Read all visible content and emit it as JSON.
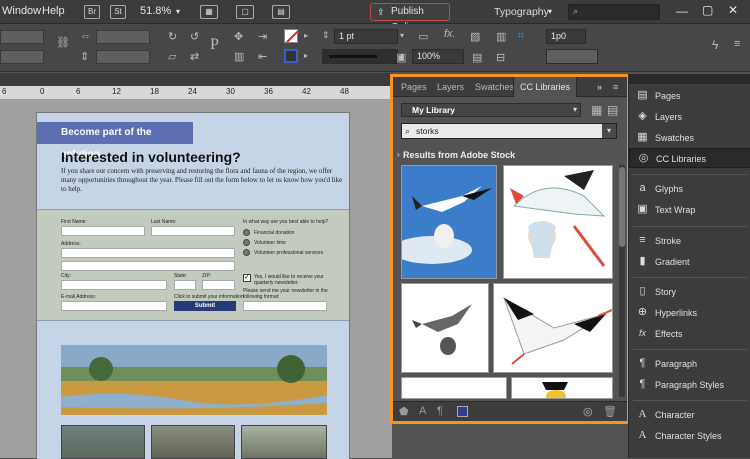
{
  "menu": {
    "window": "Window",
    "help": "Help",
    "zoom": "51.8%",
    "br": "Br",
    "st": "St"
  },
  "toolbar": {
    "publish": "Publish Online",
    "workspace": "Typography"
  },
  "control": {
    "stroke_weight": "1 pt",
    "opacity": "100%",
    "pt_value": "1p0",
    "p_icon": "P"
  },
  "ruler": {
    "numbers": [
      "6",
      "0",
      "6",
      "12",
      "18",
      "24",
      "30",
      "36",
      "42",
      "48"
    ]
  },
  "page": {
    "banner": "Become part of the solution",
    "headline": "Interested in volunteering?",
    "body": "If you share our concern with preserving and restoring the flora and fauna of the region, we offer many opportunities throughout the year. Please fill out the form below to let us know how you'd like to help.",
    "form": {
      "first_name": "First Name:",
      "last_name": "Last Name:",
      "address": "Address:",
      "city": "City:",
      "state": "State:",
      "zip": "ZIP:",
      "email": "E-mail Address:",
      "question": "In what way are you best able to help?",
      "opt1": "Financial donation",
      "opt2": "Volunteer time",
      "opt3": "Volunteer professional services",
      "newsletter": "Yes, I would like to receive your quarterly newsletter.",
      "format": "Please send me your newsletter in the following format:",
      "click_submit": "Click to submit your information",
      "submit": "Submit"
    }
  },
  "cc": {
    "tabs": [
      "Pages",
      "Layers",
      "Swatches",
      "CC Libraries"
    ],
    "library": "My Library",
    "search_value": "storks",
    "results": "Results from Adobe Stock"
  },
  "dock": {
    "items": [
      {
        "label": "Pages",
        "icon": "pages-icon",
        "glyph": "▤"
      },
      {
        "label": "Layers",
        "icon": "layers-icon",
        "glyph": "◈"
      },
      {
        "label": "Swatches",
        "icon": "swatches-icon",
        "glyph": "▦"
      },
      {
        "label": "CC Libraries",
        "icon": "cc-libraries-icon",
        "glyph": "◎"
      },
      {
        "label": "Glyphs",
        "icon": "glyphs-icon",
        "glyph": "a"
      },
      {
        "label": "Text Wrap",
        "icon": "text-wrap-icon",
        "glyph": "▣"
      },
      {
        "label": "Stroke",
        "icon": "stroke-icon",
        "glyph": "≡"
      },
      {
        "label": "Gradient",
        "icon": "gradient-icon",
        "glyph": "▮"
      },
      {
        "label": "Story",
        "icon": "story-icon",
        "glyph": "▯"
      },
      {
        "label": "Hyperlinks",
        "icon": "hyperlinks-icon",
        "glyph": "⊕"
      },
      {
        "label": "Effects",
        "icon": "effects-icon",
        "glyph": "fx"
      },
      {
        "label": "Paragraph",
        "icon": "paragraph-icon",
        "glyph": "¶"
      },
      {
        "label": "Paragraph Styles",
        "icon": "paragraph-styles-icon",
        "glyph": "¶"
      },
      {
        "label": "Character",
        "icon": "character-icon",
        "glyph": "A"
      },
      {
        "label": "Character Styles",
        "icon": "character-styles-icon",
        "glyph": "A"
      }
    ]
  },
  "colors": {
    "highlight": "#f7941d",
    "banner": "#5d6fb2",
    "submit": "#273a79"
  }
}
